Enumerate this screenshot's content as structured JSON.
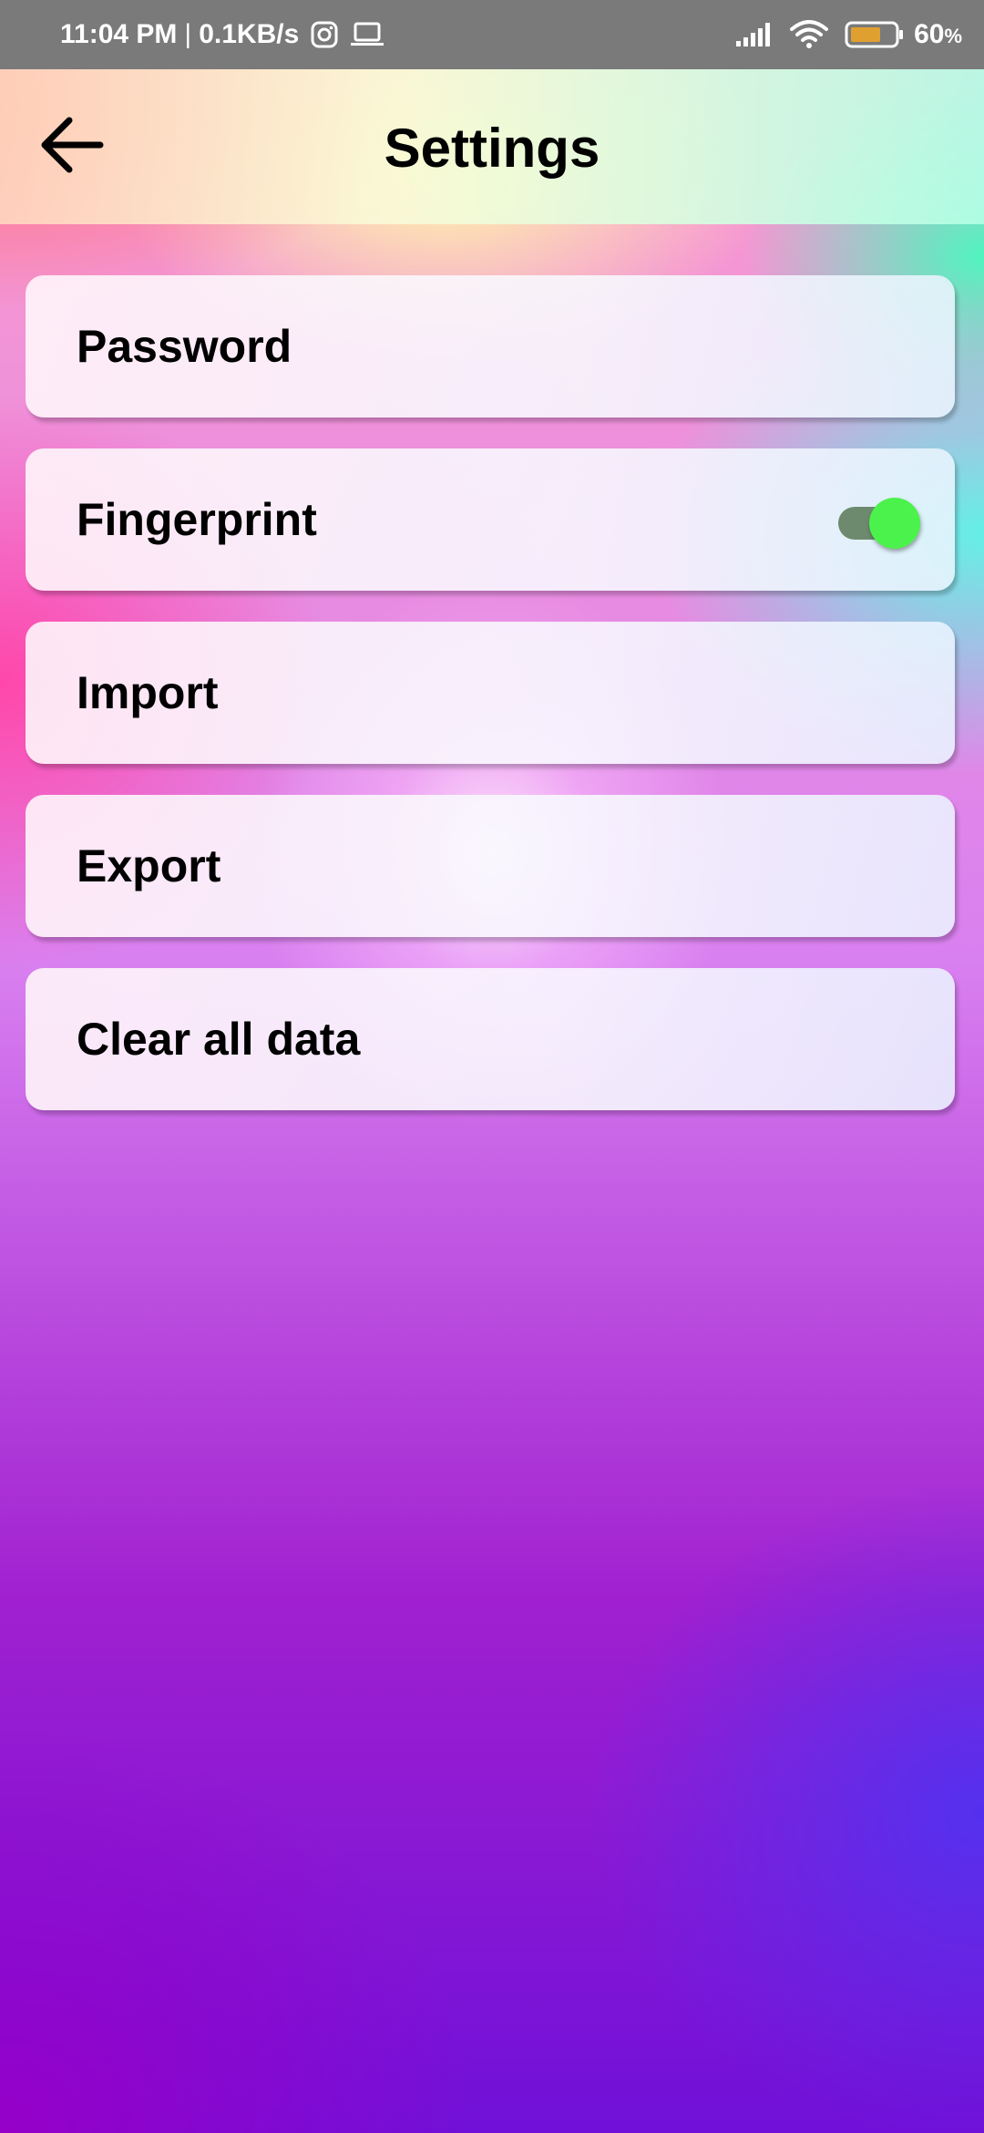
{
  "status_bar": {
    "time": "11:04 PM",
    "separator": "|",
    "network_speed": "0.1KB/s",
    "left_icons": [
      "instagram-icon",
      "laptop-icon"
    ],
    "right_icons": [
      "signal-icon",
      "wifi-icon",
      "battery-icon"
    ],
    "battery_percent": "60",
    "battery_unit": "%",
    "battery_color": "#e0a030"
  },
  "app_bar": {
    "back_icon": "arrow-left-icon",
    "title": "Settings"
  },
  "settings": {
    "items": [
      {
        "label": "Password"
      },
      {
        "label": "Fingerprint",
        "toggle": true,
        "toggle_on": true
      },
      {
        "label": "Import"
      },
      {
        "label": "Export"
      },
      {
        "label": "Clear all data"
      }
    ]
  },
  "colors": {
    "status_bar_bg": "#7a7a7a",
    "toggle_thumb_on": "#4cf24c",
    "toggle_track_on": "#6e8a6e",
    "text": "#000000"
  }
}
